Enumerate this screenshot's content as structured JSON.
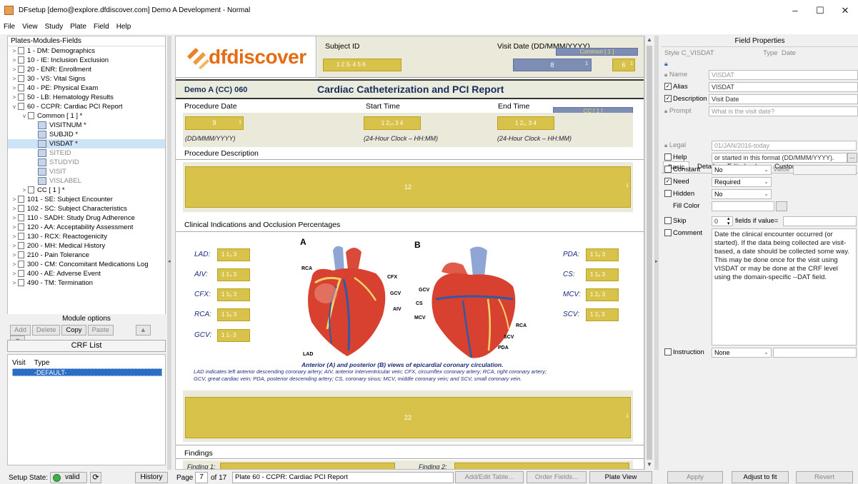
{
  "window": {
    "title": "DFsetup [demo@explore.dfdiscover.com] Demo A Development - Normal",
    "minimize": "–",
    "maximize": "☐",
    "close": "✕"
  },
  "menu": [
    "File",
    "View",
    "Study",
    "Plate",
    "Field",
    "Help"
  ],
  "left": {
    "header": "Plates-Modules-Fields",
    "tree": [
      {
        "arrow": ">",
        "label": "1 - DM: Demographics",
        "level": 0
      },
      {
        "arrow": ">",
        "label": "10 - IE: Inclusion Exclusion",
        "level": 0
      },
      {
        "arrow": ">",
        "label": "20 - ENR: Enrollment",
        "level": 0
      },
      {
        "arrow": ">",
        "label": "30 - VS: Vital Signs",
        "level": 0
      },
      {
        "arrow": ">",
        "label": "40 - PE: Physical Exam",
        "level": 0
      },
      {
        "arrow": ">",
        "label": "50 - LB: Hematology Results",
        "level": 0
      },
      {
        "arrow": "v",
        "label": "60 - CCPR: Cardiac PCI Report",
        "level": 0
      },
      {
        "arrow": "v",
        "label": "Common [ 1 ] *",
        "level": 1
      },
      {
        "arrow": "",
        "label": "VISITNUM *",
        "level": 2,
        "field": true
      },
      {
        "arrow": "",
        "label": "SUBJID *",
        "level": 2,
        "field": true
      },
      {
        "arrow": "",
        "label": "VISDAT *",
        "level": 2,
        "field": true,
        "sel": true
      },
      {
        "arrow": "",
        "label": "SITEID",
        "level": 2,
        "field": true,
        "grey": true
      },
      {
        "arrow": "",
        "label": "STUDYID",
        "level": 2,
        "field": true,
        "grey": true
      },
      {
        "arrow": "",
        "label": "VISIT",
        "level": 2,
        "field": true,
        "grey": true
      },
      {
        "arrow": "",
        "label": "VISLABEL",
        "level": 2,
        "field": true,
        "grey": true
      },
      {
        "arrow": ">",
        "label": "CC [ 1 ] *",
        "level": 1
      },
      {
        "arrow": ">",
        "label": "101 - SE: Subject Encounter",
        "level": 0
      },
      {
        "arrow": ">",
        "label": "102 - SC: Subject Characteristics",
        "level": 0
      },
      {
        "arrow": ">",
        "label": "110 - SADH: Study Drug Adherence",
        "level": 0
      },
      {
        "arrow": ">",
        "label": "120 - AA: Acceptability Assessment",
        "level": 0
      },
      {
        "arrow": ">",
        "label": "130 - RCX: Reactogenicity",
        "level": 0
      },
      {
        "arrow": ">",
        "label": "200 - MH: Medical History",
        "level": 0
      },
      {
        "arrow": ">",
        "label": "210 - Pain Tolerance",
        "level": 0
      },
      {
        "arrow": ">",
        "label": "300 - CM: Concomitant Medications Log",
        "level": 0
      },
      {
        "arrow": ">",
        "label": "400 - AE: Adverse Event",
        "level": 0
      },
      {
        "arrow": ">",
        "label": "490 - TM: Termination",
        "level": 0
      }
    ],
    "module_options": "Module options",
    "buttons": {
      "add": "Add",
      "delete": "Delete",
      "copy": "Copy",
      "paste": "Paste"
    },
    "crf_list": "CRF List",
    "crf_cols": {
      "visit": "Visit",
      "type": "Type"
    },
    "crf_default": "-DEFAULT-",
    "setup_state_label": "Setup State:",
    "setup_state_value": "valid",
    "history": "History"
  },
  "form": {
    "logo_text": "dfdiscover",
    "subject_id_label": "Subject ID",
    "visit_date_label": "Visit Date (DD/MMM/YYYY)",
    "common_tag": "Common [ 1 ]",
    "subj_field_digits": "1  2  3₇  4  5  6",
    "visit_field_num": "8",
    "visit_field_cap": "1",
    "visit_field2_num": "6",
    "visit_field2_cap": "1",
    "plate_id": "Demo A (CC) 060",
    "form_title": "Cardiac Catheterization and PCI Report",
    "procedure_date": "Procedure Date",
    "start_time": "Start Time",
    "end_time": "End Time",
    "cc_tag": "CC [ 1 ]",
    "f9": "9",
    "f9cap": "1",
    "f10": "1  2₁₀  3  4",
    "f11": "1  2₁₁  3  4",
    "hint_date": "(DD/MMM/YYYY)",
    "hint_time1": "(24-Hour Clock – HH:MM)",
    "hint_time2": "(24-Hour Clock – HH:MM)",
    "procedure_desc": "Procedure Description",
    "f12": "12",
    "f12cap": "1",
    "clinical_title": "Clinical Indications and Occlusion Percentages",
    "label_a": "A",
    "label_b": "B",
    "left_vessels": [
      {
        "name": "LAD:",
        "field": "1  1₃  3"
      },
      {
        "name": "AIV:",
        "field": "1  1₄  3"
      },
      {
        "name": "CFX:",
        "field": "1  1₅  3"
      },
      {
        "name": "RCA:",
        "field": "1  1₆  3"
      },
      {
        "name": "GCV:",
        "field": "1  1₇  3"
      }
    ],
    "right_vessels": [
      {
        "name": "PDA:",
        "field": "1  1₈  3"
      },
      {
        "name": "CS:",
        "field": "1  1₉  3"
      },
      {
        "name": "MCV:",
        "field": "1  2₀  3"
      },
      {
        "name": "SCV:",
        "field": "1  2₁  3"
      }
    ],
    "heart_a_labels": [
      "RCA",
      "CFX",
      "GCV",
      "AIV",
      "LAD"
    ],
    "heart_b_labels": [
      "GCV",
      "CS",
      "MCV",
      "RCA",
      "SCV",
      "PDA"
    ],
    "caption_title": "Anterior (A) and posterior (B) views of epicardial coronary circulation.",
    "caption_line1": "LAD indicates left anterior descending coronary artery; AIV, anterior interventricular vein; CFX, circumflex coronary artery; RCA, right coronary artery;",
    "caption_line2": "GCV, great cardiac vein; PDA, posterior descending artery; CS, coronary sinus; MCV, middle coronary vein; and SCV, small coronary vein.",
    "f22": "22",
    "f22cap": "1",
    "findings": "Findings",
    "finding1": "Finding 1:",
    "finding2": "Finding 2:"
  },
  "center_bottom": {
    "page_label": "Page",
    "page_num": "7",
    "of_label": "of 17",
    "plate_name": "Plate 60 - CCPR: Cardiac PCI Report",
    "add_edit_table": "Add/Edit Table...",
    "order_fields": "Order Fields...",
    "plate_view": "Plate View"
  },
  "right": {
    "title": "Field Properties",
    "style_label": "Style",
    "style_value": "C_VISDAT",
    "type_label": "Type",
    "type_value": "Date",
    "name_label": "Name",
    "name_value": "VISDAT",
    "alias_label": "Alias",
    "alias_value": "VISDAT",
    "description_label": "Description",
    "description_value": "Visit Date",
    "prompt_label": "Prompt",
    "prompt_value": "What is the visit date?",
    "tabs": [
      "Basic",
      "Detail",
      "Edit checks",
      "Custom"
    ],
    "legal_label": "Legal",
    "legal_value": "01/JAN/2016-today",
    "help_label": "Help",
    "help_value": "or started in this format (DD/MMM/YYYY).",
    "help_more": "...",
    "constant_label": "Constant",
    "constant_value": "No",
    "value_label": "Value",
    "need_label": "Need",
    "need_value": "Required",
    "hidden_label": "Hidden",
    "hidden_value": "No",
    "fill_color_label": "Fill Color",
    "skip_label": "Skip",
    "skip_value": "0",
    "skip_suffix": "fields if value=",
    "comment_label": "Comment",
    "comment_text": "Date the clinical encounter occurred (or started). If the data being collected are visit-based, a date should be collected some way. This may be done once for the visit using VISDAT or may be done at the CRF level using the domain-specific --DAT field.",
    "instruction_label": "Instruction",
    "instruction_value": "None",
    "apply": "Apply",
    "adjust": "Adjust to fit",
    "revert": "Revert"
  },
  "colors": {
    "field_yellow": "#d8c24a",
    "field_blue": "#7d8db4",
    "selection": "#cde4f7",
    "accent": "#2b6cc4"
  }
}
